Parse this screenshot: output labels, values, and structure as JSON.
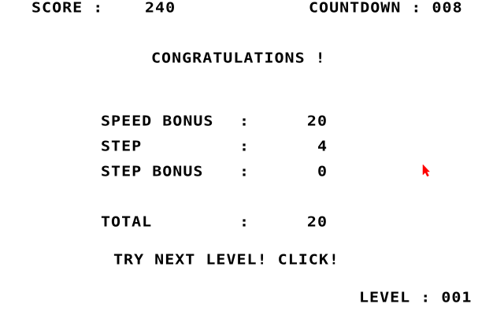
{
  "hud": {
    "score_label": "SCORE :",
    "score_value": "240",
    "countdown_label": "COUNTDOWN : 008"
  },
  "message": {
    "title": "CONGRATULATIONS !",
    "speed_bonus_label": "SPEED BONUS",
    "speed_bonus_value": "20",
    "step_label": "STEP",
    "step_value": "4",
    "step_bonus_label": "STEP BONUS",
    "step_bonus_value": "0",
    "total_label": "TOTAL",
    "total_value": "20",
    "separator": ":",
    "prompt": "TRY NEXT LEVEL! CLICK!"
  },
  "footer": {
    "level_label": "LEVEL : 001"
  },
  "colors": {
    "background": "#ffffff",
    "text": "#000000",
    "cursor": "#ff0000"
  },
  "icons": {
    "cursor": "mouse-pointer-icon"
  }
}
